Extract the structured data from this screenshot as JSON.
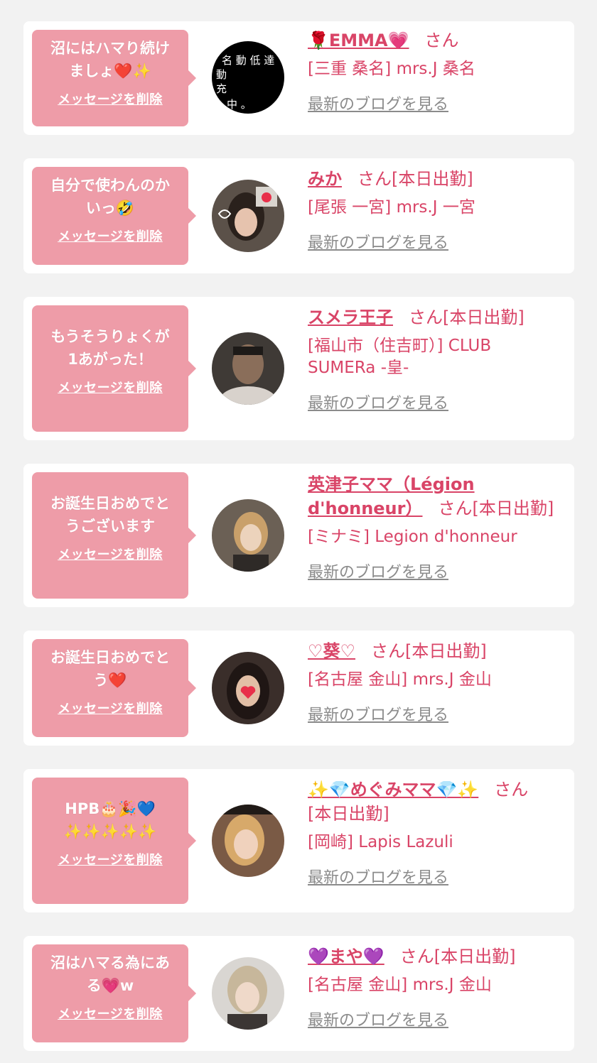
{
  "delete_label": "メッセージを削除",
  "san_label": "さん",
  "blog_label": "最新のブログを見る",
  "colors": {
    "bubble": "#ee9ca8",
    "accent": "#d94467",
    "link_gray": "#8b8b8b",
    "background": "#f2f2f2"
  },
  "cards": [
    {
      "message_line1": "沼にはハマり続け",
      "message_line2": "ましょ❤️✨",
      "name": "🌹EMMA💗",
      "status": "",
      "shop": "[三重 桑名] mrs.J 桑名",
      "avatar_text": "動 低 達 動 充 中。"
    },
    {
      "message_line1": "自分で使わんのか",
      "message_line2": "いっ🤣",
      "name": "みか",
      "status": "[本日出勤]",
      "shop": "[尾張 一宮] mrs.J 一宮"
    },
    {
      "message_line1": "もうそうりょくが",
      "message_line2": "1あがった！",
      "name": "スメラ王子",
      "status": "[本日出勤]",
      "shop_line1": "[福山市（住吉町）] CLUB",
      "shop_line2": "SUMERa -皇-"
    },
    {
      "message_line1": "お誕生日おめでと",
      "message_line2": "うございます",
      "name_line1": "英津子ママ（Légion",
      "name_line2": "d'honneur）",
      "status": "[本日出勤]",
      "shop": "[ミナミ] Legion d'honneur"
    },
    {
      "message_line1": "お誕生日おめでと",
      "message_line2": "う❤️",
      "name": "♡葵♡",
      "status": "[本日出勤]",
      "shop": "[名古屋 金山] mrs.J 金山"
    },
    {
      "message_line1": "HPB🎂🎉💙",
      "message_line2": "✨✨✨✨✨",
      "name": "✨💎めぐみママ💎✨",
      "status": "[本日出勤]",
      "shop": "[岡崎] Lapis Lazuli"
    },
    {
      "message_line1": "沼はハマる為にあ",
      "message_line2": "る💗w",
      "name": "💜まや💜",
      "status": "[本日出勤]",
      "shop": "[名古屋 金山] mrs.J 金山"
    }
  ]
}
